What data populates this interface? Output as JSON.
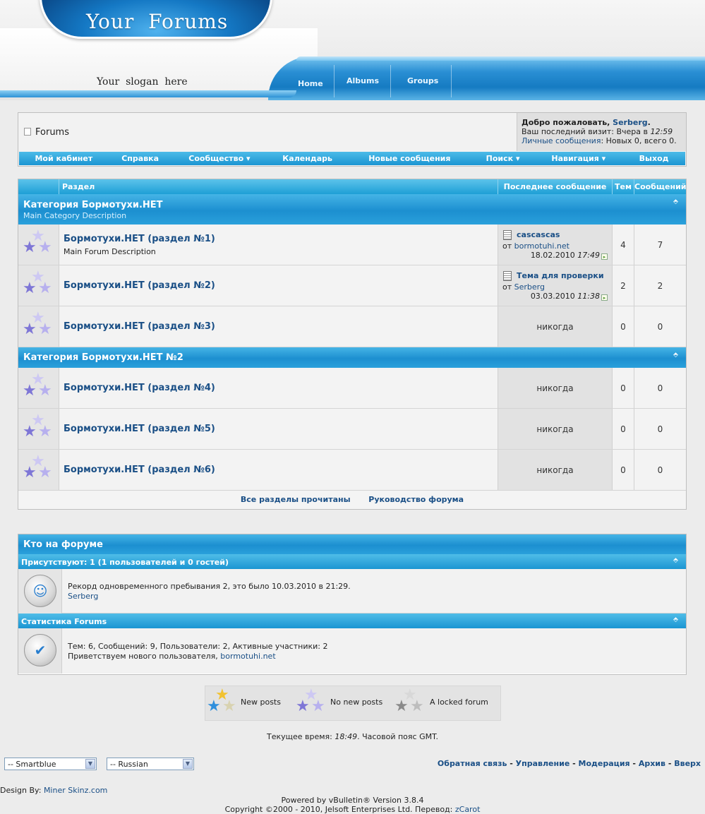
{
  "header": {
    "logo": "Your  Forums",
    "slogan": "Your  slogan  here",
    "tabs": [
      "Home",
      "Albums",
      "Groups"
    ]
  },
  "navbar": {
    "crumb": "Forums",
    "welcome_prefix": "Добро пожаловать, ",
    "welcome_user": "Serberg",
    "welcome_suffix": ".",
    "last_visit_label": "Ваш последний визит: Вчера в ",
    "last_visit_time": "12:59",
    "pm_link": "Личные сообщения",
    "pm_info": ": Новых 0, всего 0.",
    "menu": [
      "Мой кабинет",
      "Справка",
      "Сообщество",
      "Календарь",
      "Новые сообщения",
      "Поиск",
      "Навигация",
      "Выход"
    ]
  },
  "forum_table": {
    "headers": {
      "forum": "Раздел",
      "last_post": "Последнее сообщение",
      "threads": "Тем",
      "posts": "Сообщений"
    },
    "categories": [
      {
        "title": "Категория Бормотухи.НЕТ",
        "description": "Main Category Description",
        "forums": [
          {
            "title": "Бормотухи.НЕТ (раздел №1)",
            "description": "Main Forum Description",
            "last_post": {
              "title": "cascascas",
              "by_prefix": "от ",
              "by": "bormotuhi.net",
              "date": "18.02.2010",
              "time": "17:49"
            },
            "threads": "4",
            "posts": "7"
          },
          {
            "title": "Бормотухи.НЕТ (раздел №2)",
            "description": "",
            "last_post": {
              "title": "Тема для проверки",
              "by_prefix": "от ",
              "by": "Serberg",
              "date": "03.03.2010",
              "time": "11:38"
            },
            "threads": "2",
            "posts": "2"
          },
          {
            "title": "Бормотухи.НЕТ (раздел №3)",
            "description": "",
            "never": "никогда",
            "threads": "0",
            "posts": "0"
          }
        ]
      },
      {
        "title": "Категория Бормотухи.НЕТ №2",
        "description": "",
        "forums": [
          {
            "title": "Бормотухи.НЕТ (раздел №4)",
            "never": "никогда",
            "threads": "0",
            "posts": "0"
          },
          {
            "title": "Бормотухи.НЕТ (раздел №5)",
            "never": "никогда",
            "threads": "0",
            "posts": "0"
          },
          {
            "title": "Бормотухи.НЕТ (раздел №6)",
            "never": "никогда",
            "threads": "0",
            "posts": "0"
          }
        ]
      }
    ],
    "footer_links": [
      "Все разделы прочитаны",
      "Руководство форума"
    ]
  },
  "whos_online": {
    "title": "Кто на форуме",
    "present": "Присутствуют: 1 (1 пользователей и 0 гостей)",
    "record": "Рекорд одновременного пребывания 2, это было 10.03.2010 в 21:29.",
    "online_user": "Serberg",
    "stats_title": "Статистика Forums",
    "stats_line": "Тем: 6, Сообщений: 9, Пользователи: 2, Активные участники: 2",
    "welcome_new": "Приветствуем нового пользователя, ",
    "new_user": "bormotuhi.net"
  },
  "legend": [
    "New posts",
    "No new posts",
    "A locked forum"
  ],
  "time_line": {
    "prefix": "Текущее время: ",
    "time": "18:49",
    "suffix": ". Часовой пояс GMT."
  },
  "selects": {
    "style": "-- Smartblue",
    "language": "-- Russian"
  },
  "footer_links": [
    "Обратная связь",
    "Управление",
    "Модерация",
    "Архив",
    "Вверх"
  ],
  "design_by_label": "Design By: ",
  "design_by_link": "Miner Skinz.com",
  "powered": "Powered by vBulletin® Version 3.8.4",
  "copyright_prefix": "Copyright ©2000 - 2010, Jelsoft Enterprises Ltd. Перевод: ",
  "copyright_link": "zCarot",
  "colors": {
    "accent": "#1e9fd6",
    "link": "#1a4f86",
    "page_bg": "#ececec"
  }
}
